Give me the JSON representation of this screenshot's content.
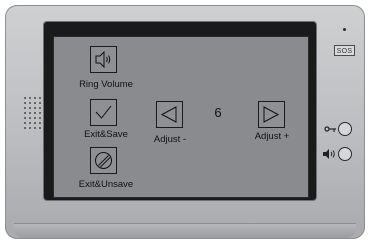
{
  "screen": {
    "ring_volume": {
      "label": "Ring Volume",
      "icon": "speaker-icon"
    },
    "exit_save": {
      "label": "Exit&Save",
      "icon": "checkmark-icon"
    },
    "exit_unsave": {
      "label": "Exit&Unsave",
      "icon": "cancel-icon"
    },
    "adjust_minus": {
      "label": "Adjust -",
      "icon": "triangle-left-icon"
    },
    "adjust_plus": {
      "label": "Adjust +",
      "icon": "triangle-right-icon"
    },
    "value": "6"
  },
  "device": {
    "sos_label": "SOS",
    "unlock_icon": "key-icon",
    "talk_icon": "speaker-volume-icon"
  },
  "colors": {
    "frame": "#bfc0c3",
    "bezel": "#1a1a1a",
    "screen": "#8a8b8e"
  }
}
